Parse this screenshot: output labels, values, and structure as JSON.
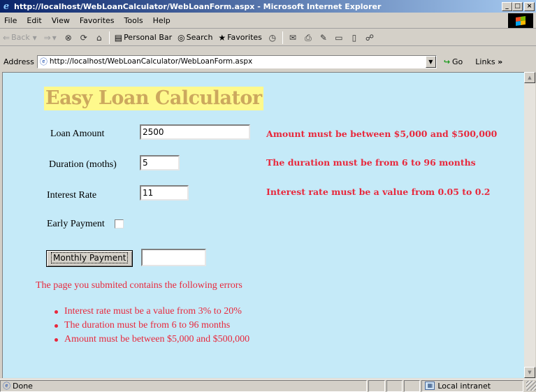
{
  "window": {
    "title": "http://localhost/WebLoanCalculator/WebLoanForm.aspx - Microsoft Internet Explorer",
    "min_glyph": "_",
    "max_glyph": "□",
    "close_glyph": "×"
  },
  "menu": {
    "items": [
      {
        "label": "File"
      },
      {
        "label": "Edit"
      },
      {
        "label": "View"
      },
      {
        "label": "Favorites"
      },
      {
        "label": "Tools"
      },
      {
        "label": "Help"
      }
    ]
  },
  "toolbar": {
    "back_label": "Back",
    "personal_bar_label": "Personal Bar",
    "search_label": "Search",
    "favorites_label": "Favorites"
  },
  "address": {
    "label": "Address",
    "url": "http://localhost/WebLoanCalculator/WebLoanForm.aspx",
    "go_label": "Go",
    "links_label": "Links"
  },
  "page": {
    "heading": "Easy Loan Calculator",
    "loan_amount_label": "Loan Amount",
    "loan_amount_value": "2500",
    "duration_label": "Duration (moths)",
    "duration_value": "5",
    "interest_label": "Interest Rate",
    "interest_value": "11",
    "early_payment_label": "Early Payment",
    "early_payment_checked": false,
    "monthly_payment_button": "Monthly Payment",
    "monthly_payment_result": "",
    "errors_inline": {
      "amount": "Amount must be between $5,000 and $500,000",
      "duration": "The duration must be from 6 to 96 months",
      "interest": "Interest rate must be a value from 0.05 to 0.2"
    },
    "summary_header": "The page you submited contains the following errors",
    "summary_items": [
      "Interest rate must be a value from 3% to 20%",
      "The duration must be from 6 to 96 months",
      "Amount must be between $5,000 and $500,000"
    ]
  },
  "status": {
    "text": "Done",
    "zone": "Local intranet"
  },
  "colors": {
    "content_bg": "#c5eaf8",
    "heading_bg": "#fef98c",
    "heading_text": "#cca85e",
    "error_text": "#e8283c",
    "titlebar_start": "#0a246a",
    "titlebar_end": "#a6caf0"
  }
}
